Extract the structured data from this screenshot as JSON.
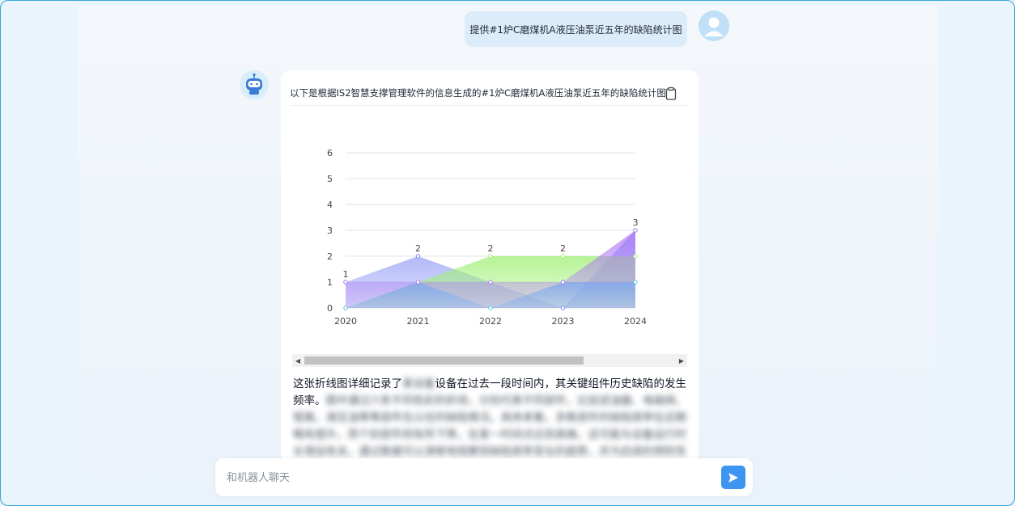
{
  "user_message": "提供#1炉C磨煤机A液压油泵近五年的缺陷统计图",
  "bot": {
    "title": "以下是根据IS2智慧支撑管理软件的信息生成的#1炉C磨煤机A液压油泵近五年的缺陷统计图",
    "description_prefix": "这张折线图详细记录了",
    "description_redacted_word": "某设备",
    "description_middle": "设备在过去一段时间内，其关键组件历史缺陷的发生频率。",
    "description_blurred": "图中通过六条不同色彩的折线，分别代表不同部件，比如滤油器、电磁阀、管路、液压油等等部件在以往的缺陷情况。具体来看，多数部件的缺陷频率在近期略有提升，而个别部件则有所下降，在某一时间点达到高峰。这可能与设备运行时长增加有关。通过数据可以清晰地观察到缺陷频率变化的趋势，并为后续的预防性维护提供参考依据，以便及时处理潜在问题。"
  },
  "input": {
    "placeholder": "和机器人聊天"
  },
  "icons": {
    "copy": "clipboard-icon",
    "send": "send-icon",
    "user": "user-avatar-icon",
    "bot": "robot-icon"
  },
  "chart_data": {
    "type": "area",
    "x": [
      "2020",
      "2021",
      "2022",
      "2023",
      "2024"
    ],
    "ylim": [
      0,
      6
    ],
    "yticks": [
      0,
      1,
      2,
      3,
      4,
      5,
      6
    ],
    "grid": true,
    "series": [
      {
        "values": [
          1,
          2,
          1,
          0,
          3
        ],
        "color": "#7b88f2",
        "labels": [
          "1",
          "2",
          "",
          "",
          "3"
        ]
      },
      {
        "values": [
          0,
          1,
          2,
          2,
          2
        ],
        "color": "#9ef072",
        "labels": [
          "",
          "",
          "2",
          "2",
          ""
        ]
      },
      {
        "values": [
          0,
          1,
          0,
          1,
          1
        ],
        "color": "#5cc4ee",
        "labels": [
          "",
          "",
          "",
          "",
          ""
        ]
      },
      {
        "values": [
          1,
          1,
          1,
          1,
          3
        ],
        "color": "#b07af5",
        "labels": [
          "",
          "",
          "",
          "",
          ""
        ]
      }
    ]
  }
}
